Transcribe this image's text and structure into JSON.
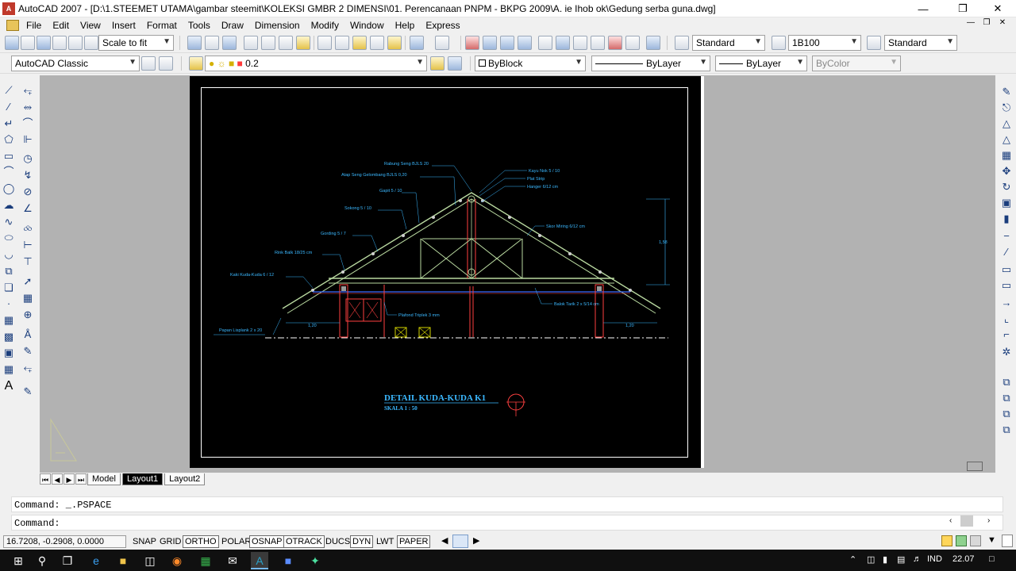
{
  "window": {
    "title": "AutoCAD 2007 - [D:\\1.STEEMET UTAMA\\gambar steemit\\KOLEKSI GMBR 2 DIMENSI\\01. Perencanaan PNPM - BKPG 2009\\A. ie Ihob ok\\Gedung serba guna.dwg]"
  },
  "menu": [
    "File",
    "Edit",
    "View",
    "Insert",
    "Format",
    "Tools",
    "Draw",
    "Dimension",
    "Modify",
    "Window",
    "Help",
    "Express"
  ],
  "toolbar1": {
    "zoom_combo": "Scale to fit",
    "text_style": "Standard",
    "dim_style": "1B100",
    "table_style": "Standard"
  },
  "toolbar2": {
    "workspace": "AutoCAD Classic",
    "layer": "0.2",
    "color": "ByBlock",
    "linetype": "ByLayer",
    "lineweight": "ByLayer",
    "plotstyle": "ByColor"
  },
  "drawing": {
    "title": "DETAIL KUDA-KUDA K1",
    "scale": "SKALA  1 : 50",
    "labels": {
      "rabung": "Rabung Seng BJLS 20",
      "atap": "Atap Seng Gelombang BJLS 0,20",
      "gapit": "Gapit 5 / 10",
      "sokong": "Sokong 5 / 10",
      "gording": "Gording  5 / 7",
      "rink": "Rink Balk 18/25 cm",
      "kaki": "Kaki Kuda-Kuda  6 / 12",
      "papan": "Papan Lisplank  2 x 20",
      "kayu_nok": "Kayu Nok 5 / 10",
      "plat": "Plat Strip",
      "hanger": "Hanger 6/12 cm",
      "skor": "Skor Miring 6/12 cm",
      "balok": "Balok Tarik 2 x 5/14 cm",
      "plafond": "Plafond Triplek 3 mm",
      "dim_left": "1,20",
      "dim_right": "1,20",
      "dim_height": "1,58"
    }
  },
  "tabs": [
    "Model",
    "Layout1",
    "Layout2"
  ],
  "command": {
    "history": "Command:  _.PSPACE",
    "prompt": "Command:"
  },
  "status": {
    "coords": "16.7208, -0.2908, 0.0000",
    "buttons": [
      "SNAP",
      "GRID",
      "ORTHO",
      "POLAR",
      "OSNAP",
      "OTRACK",
      "DUCS",
      "DYN",
      "LWT",
      "PAPER"
    ]
  },
  "taskbar": {
    "lang": "IND",
    "time": "22.07"
  }
}
